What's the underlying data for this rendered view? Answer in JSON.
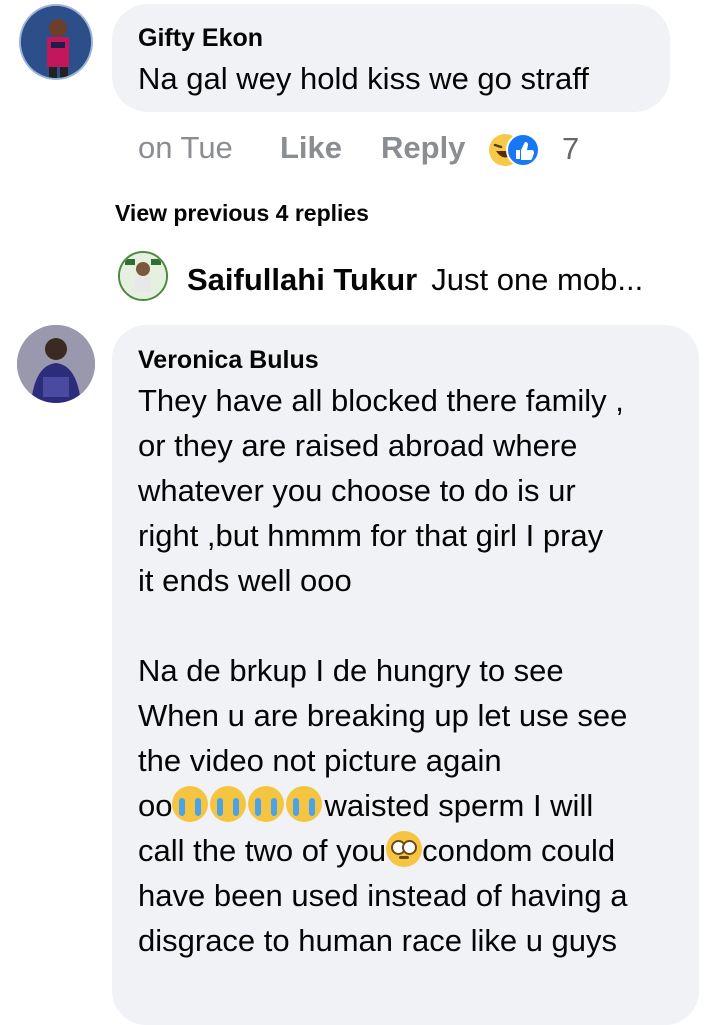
{
  "comment1": {
    "author": "Gifty Ekon",
    "text": "Na gal wey hold kiss we go straff",
    "time": "on Tue",
    "like_label": "Like",
    "reply_label": "Reply",
    "reaction_count": "7",
    "reactions": [
      "laugh-icon",
      "like-icon"
    ]
  },
  "view_previous": "View previous 4 replies",
  "reply_preview": {
    "author": "Saifullahi Tukur",
    "text": "Just one mob..."
  },
  "comment2": {
    "author": "Veronica Bulus",
    "p1_lines": [
      "They have all blocked there family ,",
      "or they are raised abroad where",
      "whatever you choose to do is ur",
      "right ,but hmmm for that girl I pray",
      "it ends well ooo"
    ],
    "p2_lines": [
      "Na de brkup I de hungry to see",
      "When u are breaking up let use see",
      "the video not picture again"
    ],
    "line_oo": "oo",
    "line_oo_after": "waisted sperm I will",
    "line_call_before": "call the two of you",
    "line_call_after": "condom could",
    "line_last1": "have been used instead of having a",
    "line_last2": "disgrace to human race like u guys",
    "emojis": [
      "crying-face-icon",
      "crying-face-icon",
      "crying-face-icon",
      "crying-face-icon",
      "flushed-face-icon"
    ]
  }
}
